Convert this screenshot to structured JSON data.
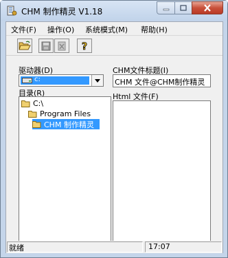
{
  "window": {
    "title": "CHM 制作精灵 V1.18"
  },
  "menu": {
    "file": "文件(F)",
    "operate": "操作(O)",
    "system_mode": "系统模式(M)",
    "help": "帮助(H)"
  },
  "toolbar": {
    "open_icon": "open-folder-icon",
    "save_icon": "floppy-disk-icon",
    "delete_icon": "delete-icon",
    "help_icon": "question-mark-icon"
  },
  "drive": {
    "label": "驱动器(D)",
    "value": "c:"
  },
  "directory": {
    "label": "目录(R)",
    "items": [
      {
        "label": "C:\\",
        "selected": false
      },
      {
        "label": "Program Files",
        "selected": false
      },
      {
        "label": "CHM 制作精灵",
        "selected": true
      }
    ]
  },
  "chm_title": {
    "label": "CHM文件标题(I)",
    "value": "CHM 文件@CHM制作精灵"
  },
  "html_files": {
    "label": "Html 文件(F)"
  },
  "status": {
    "message": "就绪",
    "time": "17:07"
  },
  "colors": {
    "selection": "#3399ff",
    "frame": "#c4d5ea",
    "close_button": "#c9503a"
  }
}
